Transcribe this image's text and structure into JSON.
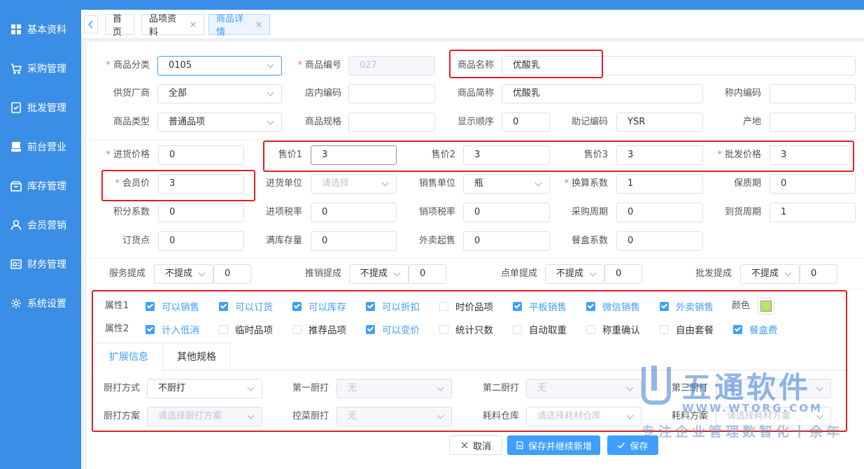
{
  "sidebar": {
    "items": [
      {
        "label": "基本资料",
        "icon": "grid-icon"
      },
      {
        "label": "采购管理",
        "icon": "cart-icon"
      },
      {
        "label": "批发管理",
        "icon": "checklist-icon"
      },
      {
        "label": "前台营业",
        "icon": "cash-register-icon"
      },
      {
        "label": "库存管理",
        "icon": "warehouse-icon"
      },
      {
        "label": "会员营销",
        "icon": "user-icon"
      },
      {
        "label": "财务管理",
        "icon": "finance-icon"
      },
      {
        "label": "系统设置",
        "icon": "gear-icon"
      }
    ]
  },
  "tabs": [
    {
      "label": "首页"
    },
    {
      "label": "品项资料",
      "close": "×"
    },
    {
      "label": "商品详情",
      "close": "×"
    }
  ],
  "basic": {
    "category_label": "商品分类",
    "category_value": "0105",
    "code_label": "商品编号",
    "code_value": "027",
    "name_label": "商品名称",
    "name_value": "优酸乳",
    "supplier_label": "供货厂商",
    "supplier_value": "全部",
    "store_code_label": "店内编码",
    "store_code_value": "",
    "short_name_label": "商品简称",
    "short_name_value": "优酸乳",
    "scale_code_label": "称内编码",
    "scale_code_value": "",
    "type_label": "商品类型",
    "type_value": "普通品项",
    "spec_label": "商品规格",
    "spec_value": "",
    "order_label": "显示顺序",
    "order_value": "0",
    "mnemonic_label": "助记编码",
    "mnemonic_value": "YSR",
    "origin_label": "产地",
    "origin_value": ""
  },
  "price": {
    "purchase_label": "进货价格",
    "purchase_value": "0",
    "price1_label": "售价1",
    "price1_value": "3",
    "price2_label": "售价2",
    "price2_value": "3",
    "price3_label": "售价3",
    "price3_value": "3",
    "wholesale_label": "批发价格",
    "wholesale_value": "3",
    "member_label": "会员价",
    "member_value": "3",
    "purchase_unit_label": "进货单位",
    "purchase_unit_placeholder": "请选择",
    "sales_unit_label": "销售单位",
    "sales_unit_value": "瓶",
    "conversion_label": "换算系数",
    "conversion_value": "1",
    "shelf_life_label": "保质期",
    "shelf_life_value": "0",
    "points_label": "积分系数",
    "points_value": "0",
    "input_tax_label": "进项税率",
    "input_tax_value": "0",
    "output_tax_label": "销项税率",
    "output_tax_value": "0",
    "purchase_cycle_label": "采购周期",
    "purchase_cycle_value": "0",
    "arrival_cycle_label": "到货周期",
    "arrival_cycle_value": "1",
    "reorder_label": "订货点",
    "reorder_value": "0",
    "full_stock_label": "满库存量",
    "full_stock_value": "0",
    "takeout_min_label": "外卖起售",
    "takeout_min_value": "0",
    "box_coef_label": "餐盒系数",
    "box_coef_value": "0"
  },
  "commission": [
    {
      "label": "服务提成",
      "mode": "不提成",
      "value": "0"
    },
    {
      "label": "推销提成",
      "mode": "不提成",
      "value": "0"
    },
    {
      "label": "点单提成",
      "mode": "不提成",
      "value": "0"
    },
    {
      "label": "批发提成",
      "mode": "不提成",
      "value": "0"
    }
  ],
  "attrs": {
    "attr1_label": "属性1",
    "attr2_label": "属性2",
    "color_label": "颜色",
    "color_value": "#b7e36b",
    "row1": [
      {
        "label": "可以销售",
        "checked": true
      },
      {
        "label": "可以订货",
        "checked": true
      },
      {
        "label": "可以库存",
        "checked": true
      },
      {
        "label": "可以折扣",
        "checked": true
      },
      {
        "label": "时价品项",
        "checked": false
      },
      {
        "label": "平板销售",
        "checked": true
      },
      {
        "label": "微信销售",
        "checked": true
      },
      {
        "label": "外卖销售",
        "checked": true
      }
    ],
    "row2": [
      {
        "label": "计入低消",
        "checked": true
      },
      {
        "label": "临时品项",
        "checked": false
      },
      {
        "label": "推荐品项",
        "checked": false
      },
      {
        "label": "可以变价",
        "checked": true
      },
      {
        "label": "统计只数",
        "checked": false
      },
      {
        "label": "自动取重",
        "checked": false
      },
      {
        "label": "称重确认",
        "checked": false
      },
      {
        "label": "自由套餐",
        "checked": false
      },
      {
        "label": "餐盒费",
        "checked": true
      }
    ]
  },
  "subtabs": [
    {
      "label": "扩展信息"
    },
    {
      "label": "其他规格"
    }
  ],
  "kitchen": {
    "print_mode_label": "厨打方式",
    "print_mode_value": "不厨打",
    "first_label": "第一厨打",
    "first_value": "无",
    "second_label": "第二厨打",
    "second_value": "无",
    "third_label": "第三厨打",
    "third_value": "无",
    "plan_label": "厨打方案",
    "plan_placeholder": "请选择厨打方案",
    "control_label": "控菜厨打",
    "control_value": "无",
    "warehouse_label": "耗料仓库",
    "warehouse_placeholder": "请选择耗材仓库",
    "material_label": "耗料方案",
    "material_placeholder": "请选择耗材方案"
  },
  "actions": {
    "cancel": "取消",
    "save_new": "保存并继续新增",
    "save": "保存"
  },
  "watermark": {
    "brand": "五通软件",
    "url": "WWW.WTORG.COM",
    "slogan": "专注企业管理数智化十余年"
  }
}
